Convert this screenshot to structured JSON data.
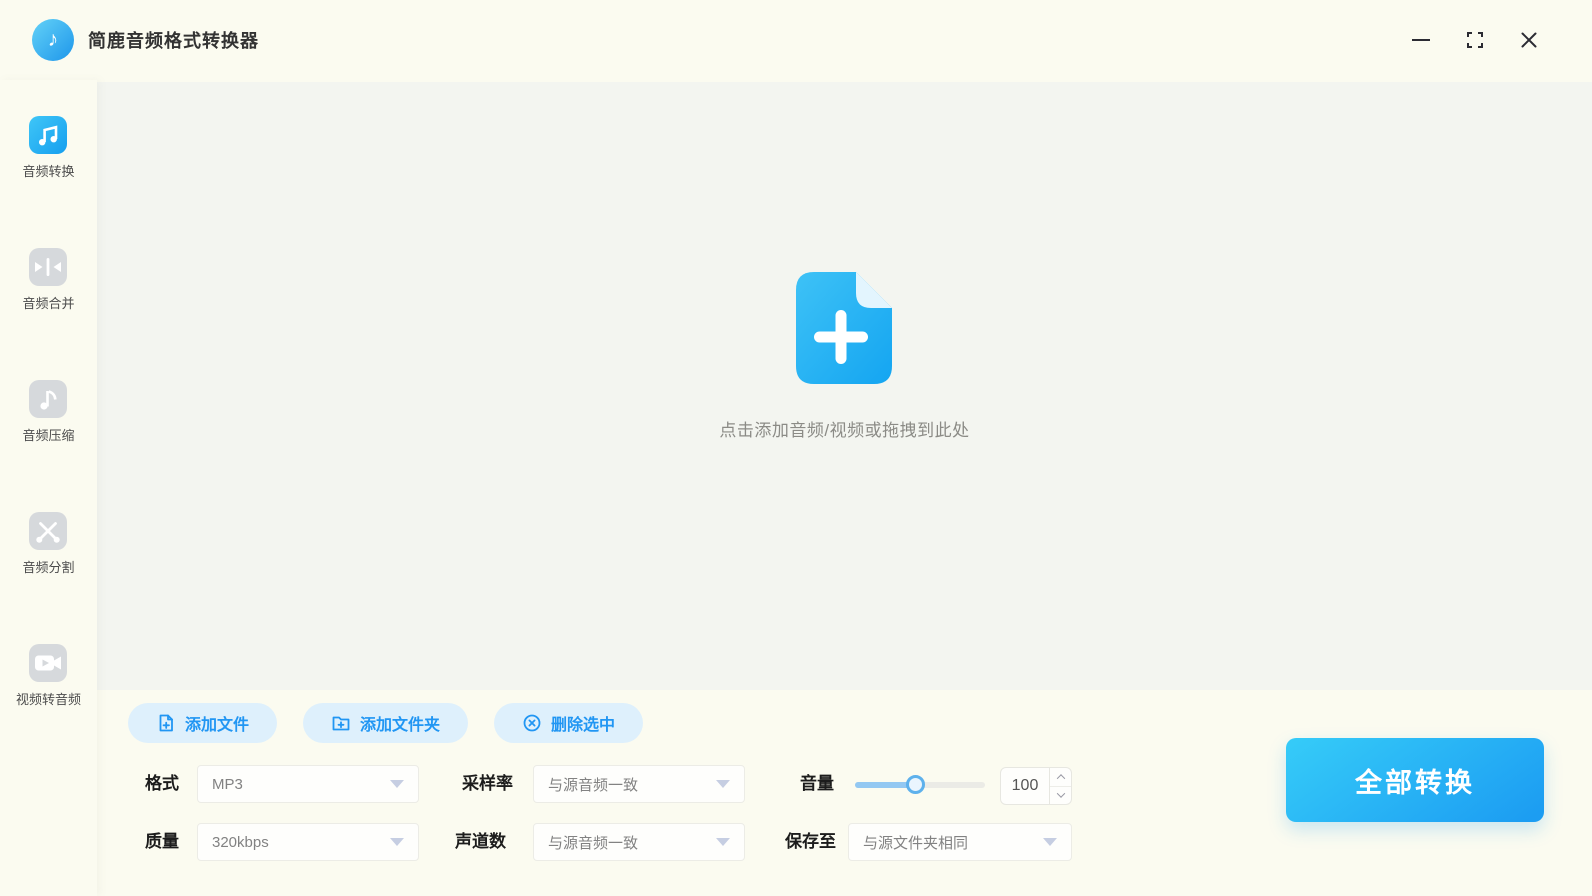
{
  "window": {
    "title": "简鹿音频格式转换器"
  },
  "sidebar": {
    "items": [
      {
        "label": "音频转换",
        "icon": "audio-convert-icon",
        "active": true
      },
      {
        "label": "音频合并",
        "icon": "audio-merge-icon",
        "active": false
      },
      {
        "label": "音频压缩",
        "icon": "audio-compress-icon",
        "active": false
      },
      {
        "label": "音频分割",
        "icon": "audio-split-icon",
        "active": false
      },
      {
        "label": "视频转音频",
        "icon": "video-to-audio-icon",
        "active": false
      }
    ]
  },
  "dropzone": {
    "hint": "点击添加音频/视频或拖拽到此处",
    "icon": "add-file-document-icon"
  },
  "toolbar": {
    "add_file_label": "添加文件",
    "add_folder_label": "添加文件夹",
    "delete_selected_label": "删除选中"
  },
  "settings": {
    "format": {
      "label": "格式",
      "value": "MP3"
    },
    "sample_rate": {
      "label": "采样率",
      "value": "与源音频一致"
    },
    "volume": {
      "label": "音量",
      "value": "100",
      "slider_percent": 47
    },
    "quality": {
      "label": "质量",
      "value": "320kbps"
    },
    "channels": {
      "label": "声道数",
      "value": "与源音频一致"
    },
    "save_to": {
      "label": "保存至",
      "value": "与源文件夹相同"
    }
  },
  "convert": {
    "label": "全部转换"
  },
  "icons": {
    "note": "♪"
  },
  "colors": {
    "accent": "#2196f3",
    "pill_background": "#def0fc",
    "convert_gradient_start": "#36ccf8",
    "convert_gradient_end": "#1c9df2",
    "active_icon_gradient_start": "#3fc6f7",
    "active_icon_gradient_end": "#169fef",
    "inactive_icon": "#d6d9dc",
    "main_area_background": "#f3f5f0",
    "chrome_background": "#fbfbf0"
  }
}
